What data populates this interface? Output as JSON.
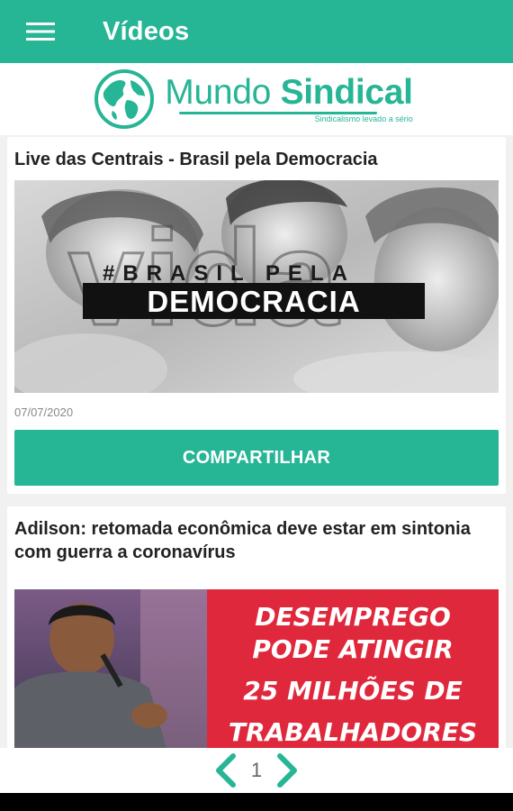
{
  "app_bar": {
    "title": "Vídeos",
    "menu_icon": "hamburger-menu-icon"
  },
  "brand": {
    "name_light": "Mundo",
    "name_bold": "Sindical",
    "tagline": "Sindicalismo levado a sério",
    "logo_icon": "globe-icon",
    "color": "#26b595"
  },
  "videos": [
    {
      "title": "Live das Centrais - Brasil pela Democracia",
      "thumbnail_overlay": "#BRASIL PELA",
      "thumbnail_headline": "DEMOCRACIA",
      "thumbnail_background_text": "vida",
      "date": "07/07/2020",
      "share_label": "COMPARTILHAR"
    },
    {
      "title": "Adilson: retomada econômica deve estar em sintonia com guerra a coronavírus",
      "thumbnail_lines": [
        "DESEMPREGO",
        "PODE ATINGIR",
        "25 MILHÕES DE",
        "TRABALHADORES"
      ]
    }
  ],
  "pager": {
    "current_page": "1",
    "prev_icon": "chevron-left-icon",
    "next_icon": "chevron-right-icon"
  },
  "colors": {
    "accent": "#26b595",
    "thumb_red": "#e0283c"
  }
}
